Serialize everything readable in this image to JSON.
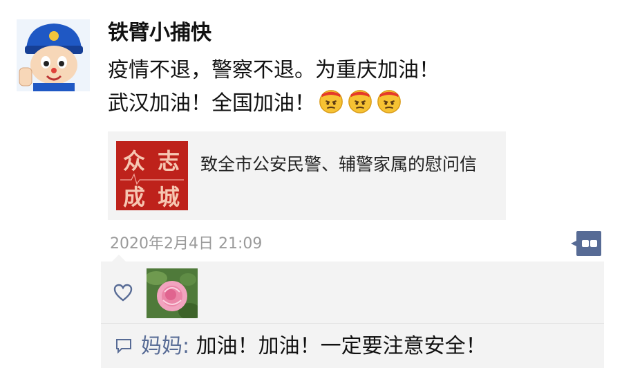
{
  "post": {
    "author": "铁臂小捕快",
    "text_line1": "疫情不退，警察不退。为重庆加油！",
    "text_line2": "武汉加油！全国加油！",
    "emojis": [
      "angry-face-icon",
      "angry-face-icon",
      "angry-face-icon"
    ],
    "timestamp": "2020年2月4日 21:09"
  },
  "link_card": {
    "thumbnail_chars": [
      "众",
      "志",
      "成",
      "城"
    ],
    "title": "致全市公安民警、辅警家属的慰问信"
  },
  "reactions": {
    "comments": [
      {
        "author": "妈妈",
        "separator": ": ",
        "text": "加油！加油！一定要注意安全！"
      }
    ]
  },
  "colors": {
    "link_blue": "#576b95",
    "card_bg": "#f3f3f3",
    "thumb_red": "#c9271f",
    "timestamp_gray": "#9a9a9a"
  }
}
